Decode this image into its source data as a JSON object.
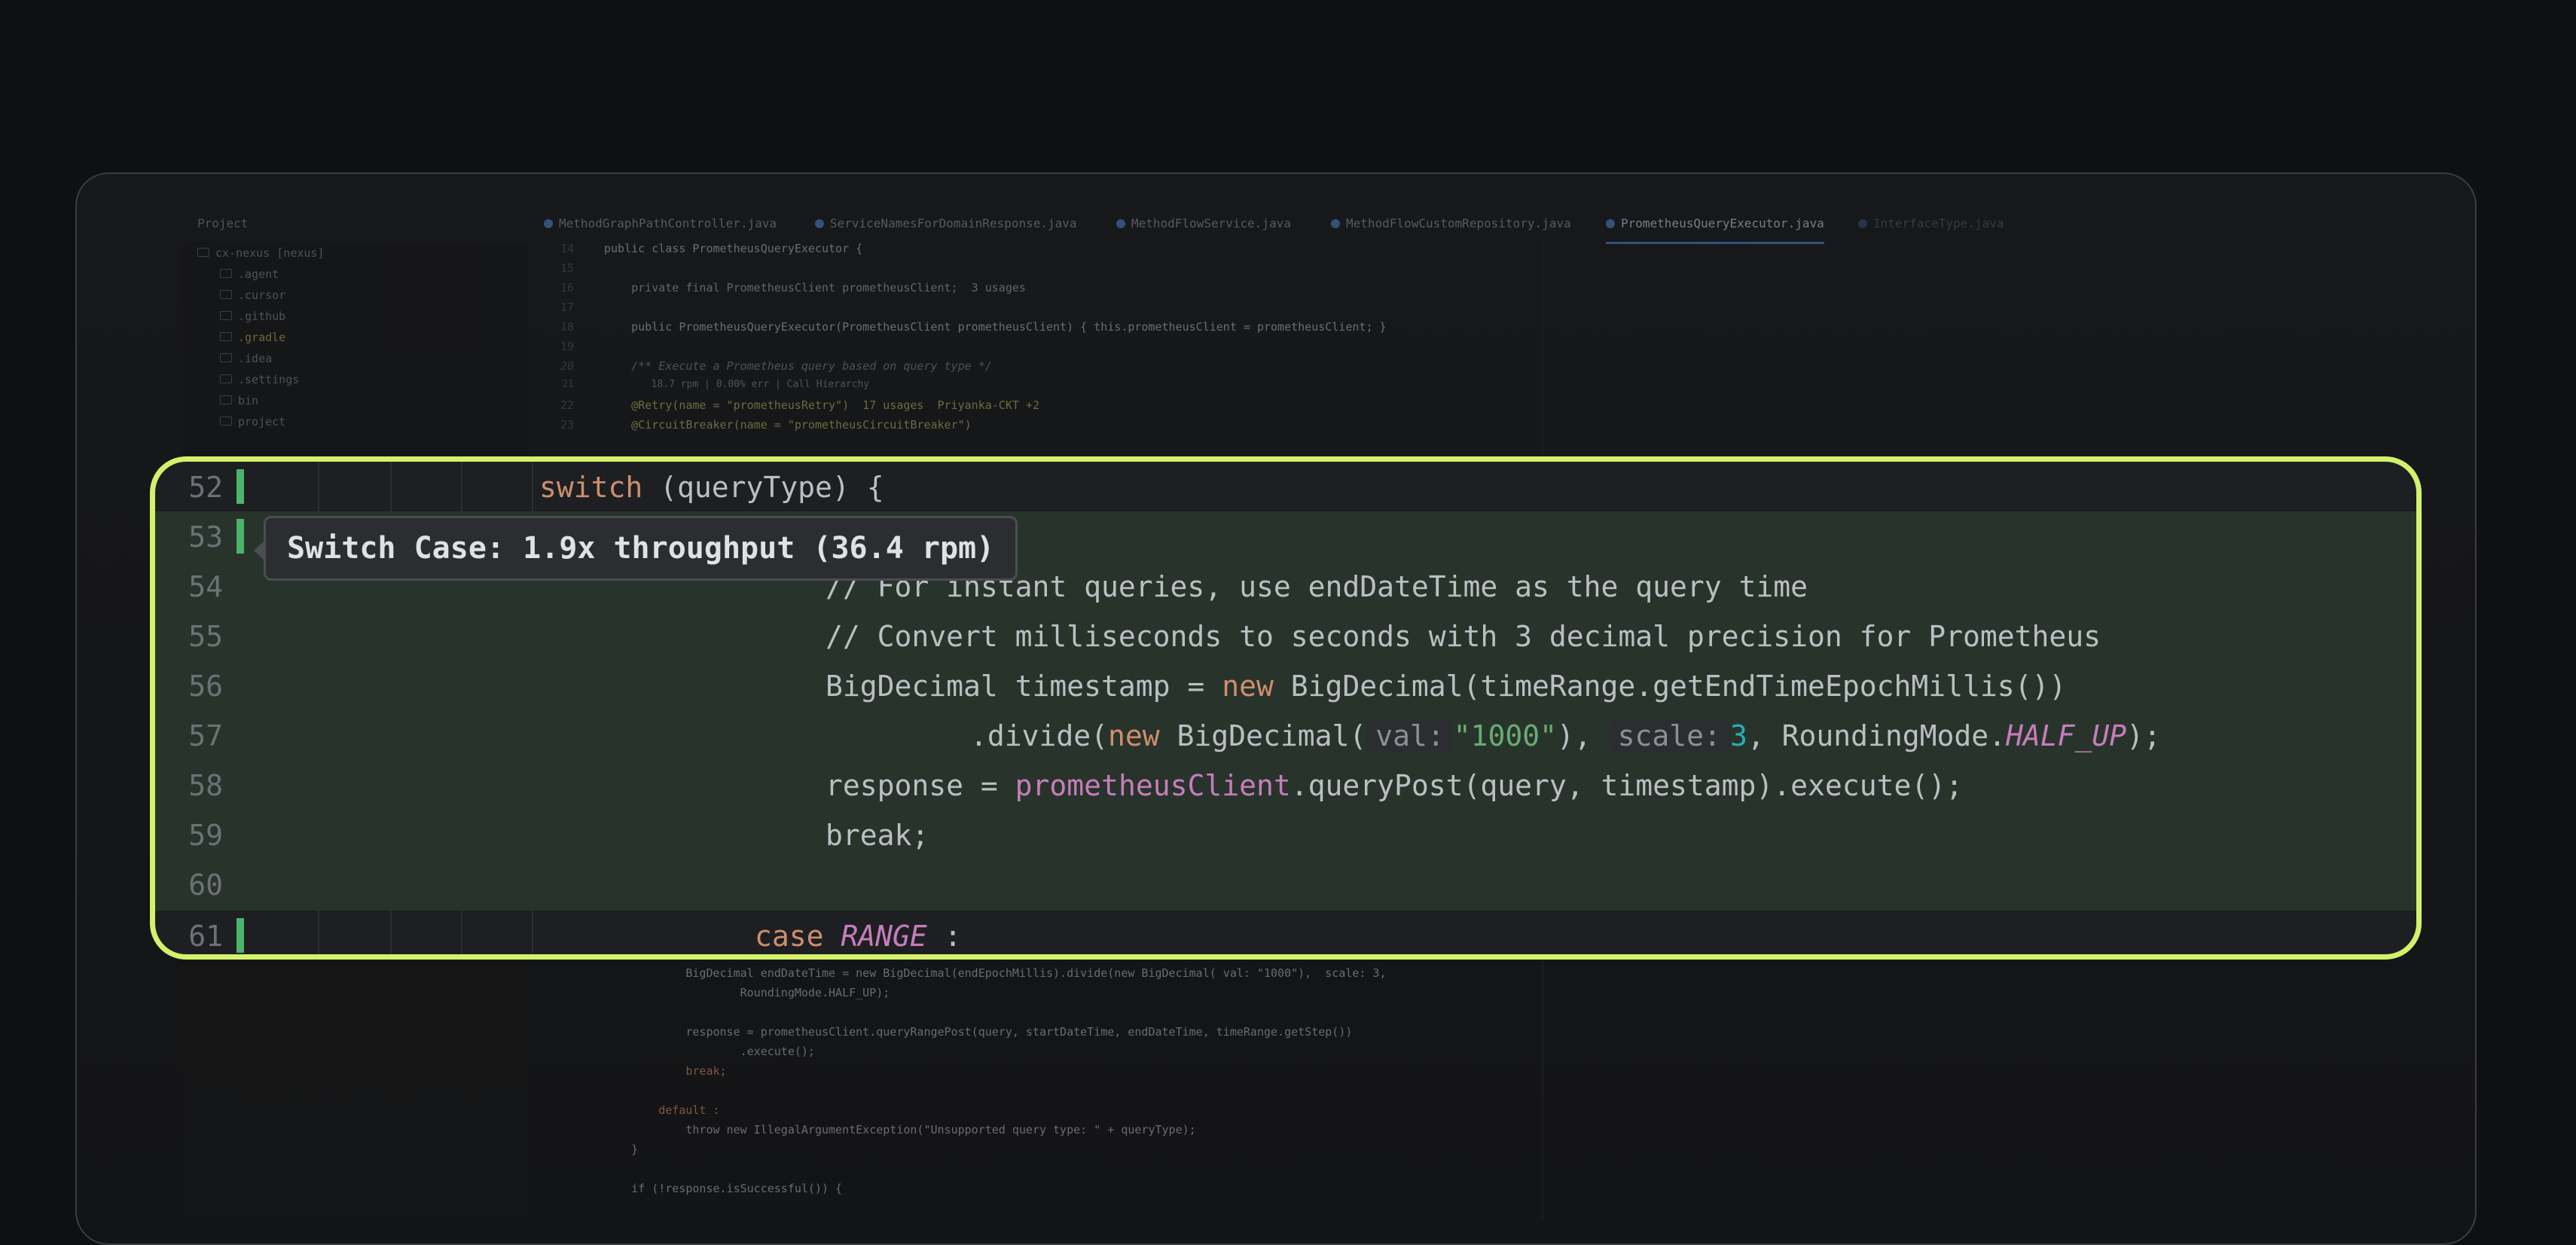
{
  "ide": {
    "project_label": "Project",
    "tabs": [
      "MethodGraphPathController.java",
      "ServiceNamesForDomainResponse.java",
      "MethodFlowService.java",
      "MethodFlowCustomRepository.java",
      "PrometheusQueryExecutor.java",
      "InterfaceType.java"
    ],
    "tree": [
      ".agent",
      ".cursor",
      ".github",
      ".gradle",
      ".idea",
      ".settings",
      "bin",
      "project"
    ],
    "tree_root": "cx-nexus [nexus]",
    "code": [
      {
        "n": "14",
        "t": "public class PrometheusQueryExecutor {"
      },
      {
        "n": "15",
        "t": ""
      },
      {
        "n": "16",
        "t": "    private final PrometheusClient prometheusClient;  3 usages"
      },
      {
        "n": "17",
        "t": ""
      },
      {
        "n": "18",
        "t": "    public PrometheusQueryExecutor(PrometheusClient prometheusClient) { this.prometheusClient = prometheusClient; }"
      },
      {
        "n": "19",
        "t": ""
      },
      {
        "n": "20",
        "t": "    /** Execute a Prometheus query based on query type */"
      },
      {
        "n": "21",
        "t": "        18.7 rpm | 0.00% err | Call Hierarchy"
      },
      {
        "n": "22",
        "t": "    @Retry(name = \"prometheusRetry\")  17 usages  Priyanka-CKT +2"
      },
      {
        "n": "23",
        "t": "    @CircuitBreaker(name = \"prometheusCircuitBreaker\")"
      }
    ],
    "code_below": [
      "            BigDecimal endDateTime = new BigDecimal(endEpochMillis).divide(new BigDecimal( val: \"1000\"),  scale: 3,",
      "                    RoundingMode.HALF_UP);",
      "",
      "            response = prometheusClient.queryRangePost(query, startDateTime, endDateTime, timeRange.getStep())",
      "                    .execute();",
      "            break;",
      "",
      "        default :",
      "            throw new IllegalArgumentException(\"Unsupported query type: \" + queryType);",
      "    }",
      "",
      "    if (!response.isSuccessful()) {"
    ]
  },
  "zoom": {
    "tooltip": "Switch Case: 1.9x throughput (36.4 rpm)",
    "lines": [
      {
        "n": "52",
        "mark": true,
        "hl": false
      },
      {
        "n": "53",
        "mark": true,
        "hl": true
      },
      {
        "n": "54",
        "mark": false,
        "hl": true
      },
      {
        "n": "55",
        "mark": false,
        "hl": true
      },
      {
        "n": "56",
        "mark": false,
        "hl": true
      },
      {
        "n": "57",
        "mark": false,
        "hl": true
      },
      {
        "n": "58",
        "mark": false,
        "hl": true
      },
      {
        "n": "59",
        "mark": false,
        "hl": true
      },
      {
        "n": "60",
        "mark": false,
        "hl": true
      },
      {
        "n": "61",
        "mark": true,
        "hl": false
      }
    ],
    "text": {
      "l52_kw": "switch",
      "l52_rest": " (queryType) {",
      "l54": "// For instant queries, use endDateTime as the query time",
      "l55": "// Convert milliseconds to seconds with 3 decimal precision for Prometheus",
      "l56_a": "BigDecimal timestamp = ",
      "l56_new": "new",
      "l56_b": " BigDecimal(timeRange.getEndTimeEpochMillis())",
      "l57_a": ".divide(",
      "l57_new": "new",
      "l57_b": " BigDecimal(",
      "l57_hint1": "val:",
      "l57_str": "\"1000\"",
      "l57_c": "), ",
      "l57_hint2": "scale:",
      "l57_num": "3",
      "l57_d": ", RoundingMode.",
      "l57_const": "HALF_UP",
      "l57_e": ");",
      "l58_a": "response = ",
      "l58_field": "prometheusClient",
      "l58_b": ".queryPost(query, timestamp).execute();",
      "l59": "break;",
      "l61_kw": "case",
      "l61_const": "RANGE",
      "l61_rest": " :"
    }
  },
  "colors": {
    "accent_border": "#d4f16b",
    "highlight_bg": "#28342b",
    "gutter_mark": "#4bb36a"
  }
}
